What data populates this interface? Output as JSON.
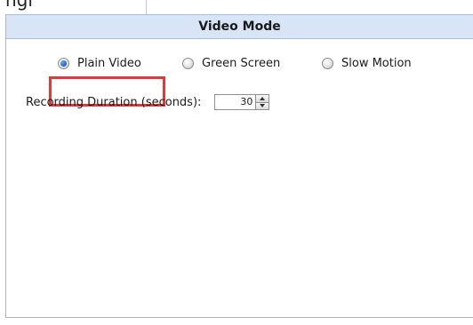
{
  "top_strip": {
    "partial_text": "ngi"
  },
  "panel": {
    "title": "Video Mode"
  },
  "video_mode": {
    "options": [
      {
        "label": "Plain Video",
        "selected": true
      },
      {
        "label": "Green Screen",
        "selected": false
      },
      {
        "label": "Slow Motion",
        "selected": false
      }
    ],
    "highlight_color": "#e0393a"
  },
  "recording_duration": {
    "label": "Recording Duration (seconds):",
    "value": "30"
  },
  "colors": {
    "header_background": "#d8e5f7",
    "radio_selected": "#2a66c7"
  },
  "icons": {
    "spinner_up": "triangle-up-icon",
    "spinner_down": "triangle-down-icon"
  }
}
